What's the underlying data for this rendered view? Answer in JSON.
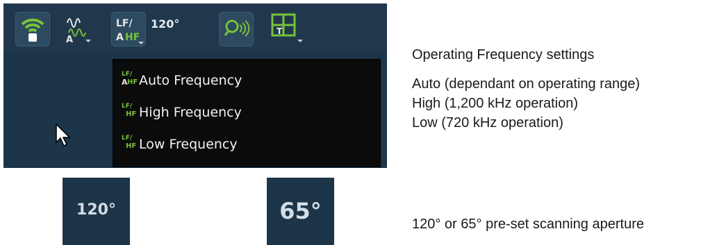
{
  "toolbar": {
    "icons": [
      "wifi-icon",
      "waveform-icon",
      "frequency-icon",
      "aperture-label",
      "sonar-search-icon",
      "grid-layout-icon"
    ],
    "aperture_label": "120°",
    "freq_icon_top": "LF/",
    "freq_icon_left": "A",
    "freq_icon_right": "HF",
    "waveform_sub": "A"
  },
  "menu": {
    "items": [
      {
        "label": "Auto Frequency",
        "icon_top": "LF/",
        "icon_left": "A",
        "icon_right": "HF"
      },
      {
        "label": "High Frequency",
        "icon_top": "LF/",
        "icon_left": "",
        "icon_right": "HF"
      },
      {
        "label": "Low Frequency",
        "icon_top": "LF/",
        "icon_left": "",
        "icon_right": "HF"
      }
    ]
  },
  "apertures": {
    "wide": "120°",
    "narrow": "65°"
  },
  "doc": {
    "heading": "Operating Frequency settings",
    "line_auto": "Auto (dependant on operating range)",
    "line_high": "High (1,200 kHz operation)",
    "line_low": "Low (720 kHz operation)",
    "aperture_caption": "120° or 65° pre-set scanning aperture"
  },
  "colors": {
    "panel": "#1c3549",
    "accent": "#78c23a",
    "menu_bg": "#0b0b0b"
  }
}
